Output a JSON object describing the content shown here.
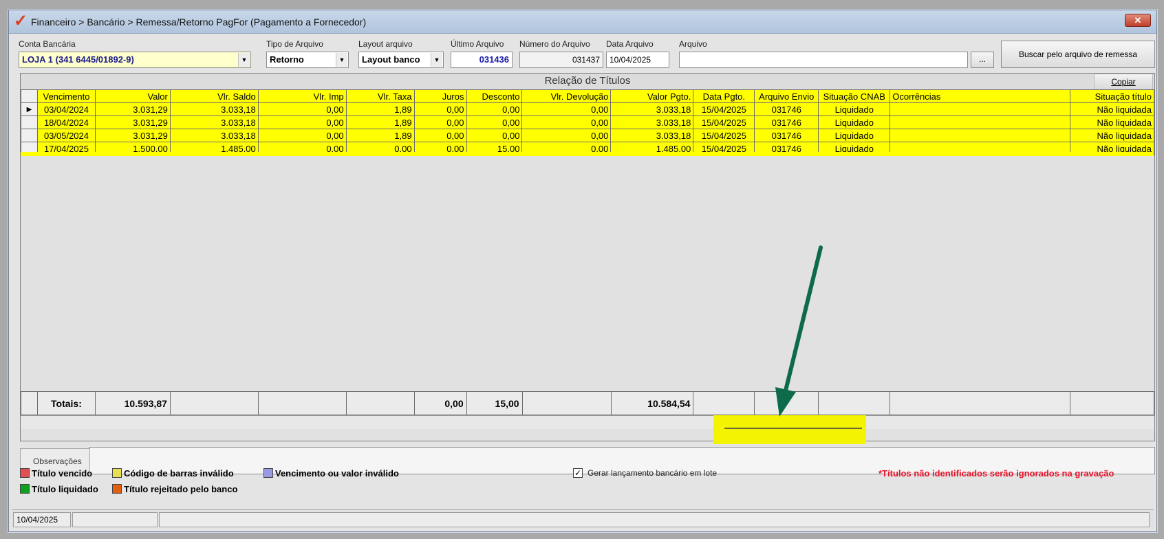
{
  "window": {
    "title": "Financeiro > Bancário > Remessa/Retorno PagFor (Pagamento  a Fornecedor)",
    "close_glyph": "✕"
  },
  "form": {
    "conta_label": "Conta Bancária",
    "conta_value": "LOJA 1 (341 6445/01892-9)",
    "tipo_label": "Tipo de Arquivo",
    "tipo_value": "Retorno",
    "layout_label": "Layout arquivo",
    "layout_value": "Layout banco",
    "ultimo_label": "Último Arquivo",
    "ultimo_value": "031436",
    "numero_label": "Número do Arquivo",
    "numero_value": "031437",
    "data_label": "Data Arquivo",
    "data_value": "10/04/2025",
    "arquivo_label": "Arquivo",
    "arquivo_value": "",
    "browse_label": "...",
    "buscar_label": "Buscar pelo arquivo de remessa"
  },
  "grid": {
    "section_title": "Relação de Títulos",
    "copy_label": "Copiar",
    "current_row_marker": "▶",
    "columns": [
      "Vencimento",
      "Valor",
      "Vlr. Saldo",
      "Vlr. Imp",
      "Vlr. Taxa",
      "Juros",
      "Desconto",
      "Vlr. Devolução",
      "Valor Pgto.",
      "Data Pgto.",
      "Arquivo Envio",
      "Situação CNAB",
      "Ocorrências",
      "Situação título"
    ],
    "rows": [
      [
        "03/04/2024",
        "3.031,29",
        "3.033,18",
        "0,00",
        "1,89",
        "0,00",
        "0,00",
        "0,00",
        "3.033,18",
        "15/04/2025",
        "031746",
        "Liquidado",
        "",
        "Não liquidada"
      ],
      [
        "18/04/2024",
        "3.031,29",
        "3.033,18",
        "0,00",
        "1,89",
        "0,00",
        "0,00",
        "0,00",
        "3.033,18",
        "15/04/2025",
        "031746",
        "Liquidado",
        "",
        "Não liquidada"
      ],
      [
        "03/05/2024",
        "3.031,29",
        "3.033,18",
        "0,00",
        "1,89",
        "0,00",
        "0,00",
        "0,00",
        "3.033,18",
        "15/04/2025",
        "031746",
        "Liquidado",
        "",
        "Não liquidada"
      ],
      [
        "17/04/2025",
        "1.500,00",
        "1.485,00",
        "0,00",
        "0,00",
        "0,00",
        "15,00",
        "0,00",
        "1.485,00",
        "15/04/2025",
        "031746",
        "Liquidado",
        "",
        "Não liquidada"
      ]
    ],
    "totals": {
      "label": "Totais:",
      "valor": "10.593,87",
      "juros": "0,00",
      "desconto": "15,00",
      "valor_pgto": "10.584,54"
    }
  },
  "observacoes_tab": "Observações",
  "legend": [
    {
      "label": "Título vencido",
      "color": "#e05050"
    },
    {
      "label": "Código de barras inválido",
      "color": "#e8e050"
    },
    {
      "label": "Vencimento ou valor inválido",
      "color": "#9a9ae0"
    },
    {
      "label": "Título liquidado",
      "color": "#10a020"
    },
    {
      "label": "Título rejeitado pelo banco",
      "color": "#e06010"
    }
  ],
  "gerar_lancamento": {
    "label": "Gerar lançamento bancário em lote",
    "checked": true,
    "check_glyph": "✓"
  },
  "warning": "*Títulos não identificados serão ignorados na gravação",
  "status": {
    "date": "10/04/2025"
  },
  "colors": {
    "row_highlight": "#ffff00",
    "annotation_arrow": "#0e6b4a",
    "warning": "#e8132a",
    "ultimo_arquivo_text": "#1a1aa8"
  }
}
